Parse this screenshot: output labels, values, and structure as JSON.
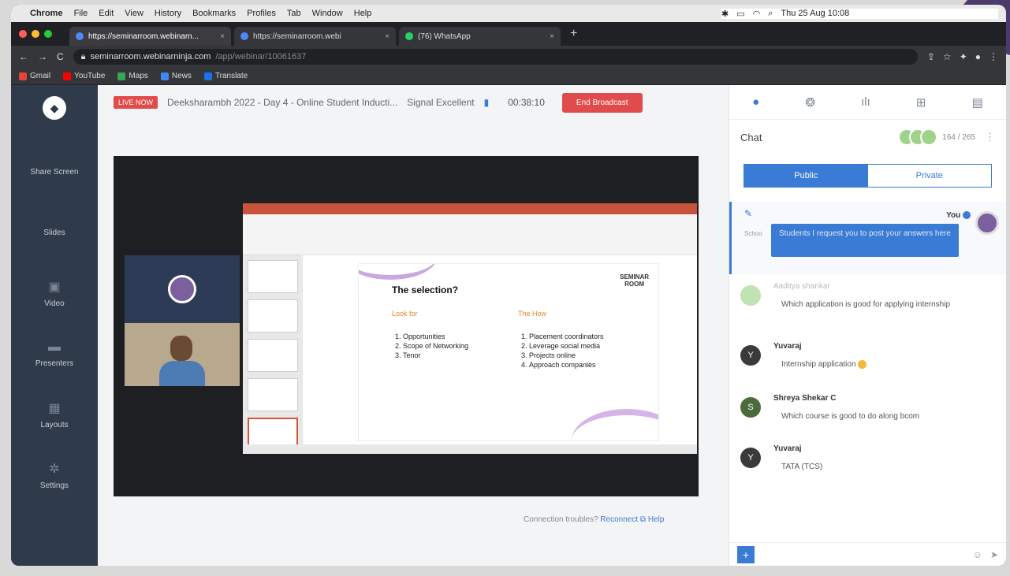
{
  "menubar": {
    "app": "Chrome",
    "items": [
      "File",
      "Edit",
      "View",
      "History",
      "Bookmarks",
      "Profiles",
      "Tab",
      "Window",
      "Help"
    ],
    "datetime": "Thu 25 Aug 10:08"
  },
  "tabs": [
    {
      "title": "https://seminarroom.webinarn...",
      "close": "×"
    },
    {
      "title": "https://seminarroom.webi",
      "close": "×"
    },
    {
      "title": "(76) WhatsApp",
      "close": "×"
    }
  ],
  "new_tab": "+",
  "address": {
    "url_host": "seminarroom.webinarninja.com",
    "url_path": "/app/webinar/10061637"
  },
  "bookmarks": [
    "Gmail",
    "YouTube",
    "Maps",
    "News",
    "Translate"
  ],
  "nav": [
    {
      "label": "Share Screen"
    },
    {
      "label": "Slides"
    },
    {
      "label": "Video"
    },
    {
      "label": "Presenters"
    },
    {
      "label": "Layouts"
    },
    {
      "label": "Settings"
    }
  ],
  "topbar": {
    "live": "LIVE NOW",
    "title": "Deeksharambh 2022 - Day 4 - Online Student Inducti...",
    "signal": "Signal Excellent",
    "timer": "00:38:10",
    "end": "End Broadcast"
  },
  "slide": {
    "title": "The selection?",
    "brand_line1": "SEMINAR",
    "brand_line2": "ROOM",
    "left_head": "Look for",
    "left_items": [
      "Opportunities",
      "Scope of Networking",
      "Tenor"
    ],
    "right_head": "The How",
    "right_items": [
      "Placement coordinators",
      "Leverage social media",
      "Projects online",
      "Approach companies"
    ]
  },
  "connection": {
    "text": "Connection troubles?",
    "reconnect": "Reconnect",
    "help": "Help"
  },
  "chat": {
    "title": "Chat",
    "count": "164 / 265",
    "public": "Public",
    "private": "Private",
    "pinned": {
      "you": "You",
      "tiny": "Schoo",
      "text": "Students I request you to post your answers here"
    },
    "messages": [
      {
        "initial": "",
        "name": "Aaditya shankar",
        "text": "Which application is good for applying internship"
      },
      {
        "initial": "Y",
        "name": "Yuvaraj",
        "text": "Internship application"
      },
      {
        "initial": "S",
        "name": "Shreya Shekar C",
        "text": "Which course is good to do along bcom"
      },
      {
        "initial": "Y",
        "name": "Yuvaraj",
        "text": "TATA (TCS)"
      }
    ]
  },
  "colors": {
    "accent": "#3a7bd5",
    "live": "#e24b4b",
    "sidebar": "#2f3a4a"
  }
}
